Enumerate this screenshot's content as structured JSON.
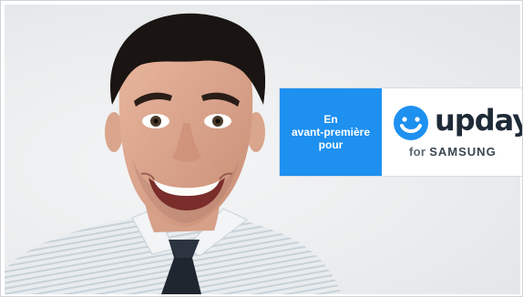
{
  "badge": {
    "left_lines": [
      "En",
      "avant-première",
      "pour"
    ],
    "brand": "upday",
    "for": "for",
    "partner": "SAMSUNG"
  },
  "colors": {
    "accent_blue": "#1e90f0",
    "brand_text": "#1e2a37",
    "background": "#eceeef"
  },
  "image": {
    "subject": "smiling-man-portrait"
  }
}
